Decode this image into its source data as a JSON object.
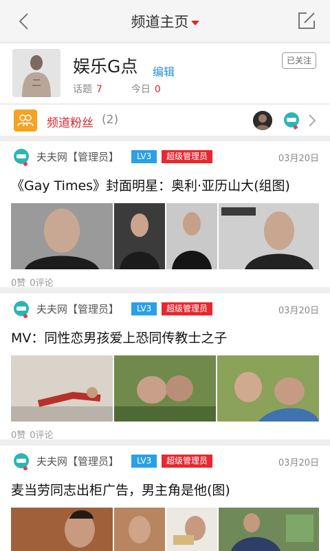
{
  "header": {
    "title": "频道主页",
    "back_icon": "chevron-left-icon",
    "edit_icon": "compose-icon"
  },
  "channel": {
    "name": "娱乐G点",
    "edit_label": "编辑",
    "topics_label": "话题",
    "topics_count": "7",
    "today_label": "今日",
    "today_count": "0",
    "follow_state": "已关注"
  },
  "fans": {
    "label": "频道粉丝",
    "count": "(2)"
  },
  "posts": [
    {
      "author": "夫夫网【管理员】",
      "level": "LV3",
      "role": "超级管理员",
      "date": "03月20日",
      "title": "《Gay Times》封面明星：奥利·亚历山大(组图)",
      "likes": "0赞",
      "comments": "0评论"
    },
    {
      "author": "夫夫网【管理员】",
      "level": "LV3",
      "role": "超级管理员",
      "date": "03月20日",
      "title": "MV：同性恋男孩爱上恐同传教士之子",
      "likes": "0赞",
      "comments": "0评论"
    },
    {
      "author": "夫夫网【管理员】",
      "level": "LV3",
      "role": "超级管理员",
      "date": "03月20日",
      "title": "麦当劳同志出柜广告，男主角是他(图)"
    }
  ],
  "colors": {
    "accent_red": "#d8262e",
    "link_blue": "#2a8fd9",
    "level_blue": "#2aa0e6",
    "fans_orange": "#f4a322"
  }
}
